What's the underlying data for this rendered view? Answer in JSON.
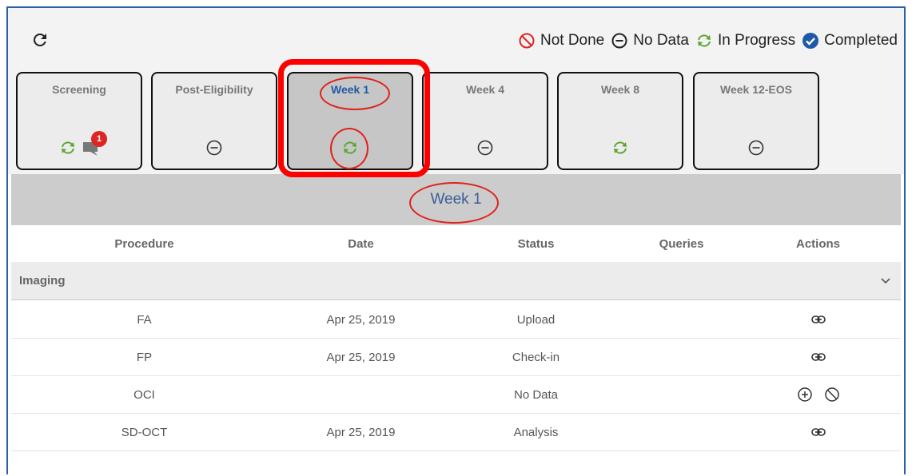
{
  "legend": {
    "not_done": "Not Done",
    "no_data": "No Data",
    "in_progress": "In Progress",
    "completed": "Completed",
    "colors": {
      "not_done": "#e02424",
      "in_progress": "#5aa632",
      "completed": "#1e5aa6"
    }
  },
  "steps": [
    {
      "label": "Screening",
      "status": "in-progress",
      "comment_count": "1"
    },
    {
      "label": "Post-Eligibility",
      "status": "no-data"
    },
    {
      "label": "Week 1",
      "status": "in-progress",
      "active": true
    },
    {
      "label": "Week 4",
      "status": "no-data"
    },
    {
      "label": "Week 8",
      "status": "in-progress"
    },
    {
      "label": "Week 12-EOS",
      "status": "no-data"
    }
  ],
  "selected_week": "Week 1",
  "table": {
    "headers": [
      "Procedure",
      "Date",
      "Status",
      "Queries",
      "Actions"
    ],
    "group": "Imaging",
    "rows": [
      {
        "procedure": "FA",
        "date": "Apr 25, 2019",
        "status": "Upload",
        "queries": "",
        "actions": [
          "link-icon"
        ]
      },
      {
        "procedure": "FP",
        "date": "Apr 25, 2019",
        "status": "Check-in",
        "queries": "",
        "actions": [
          "link-icon"
        ]
      },
      {
        "procedure": "OCI",
        "date": "",
        "status": "No Data",
        "queries": "",
        "actions": [
          "plus-circle-icon",
          "not-done-icon"
        ]
      },
      {
        "procedure": "SD-OCT",
        "date": "Apr 25, 2019",
        "status": "Analysis",
        "queries": "",
        "actions": [
          "link-icon"
        ]
      }
    ]
  }
}
